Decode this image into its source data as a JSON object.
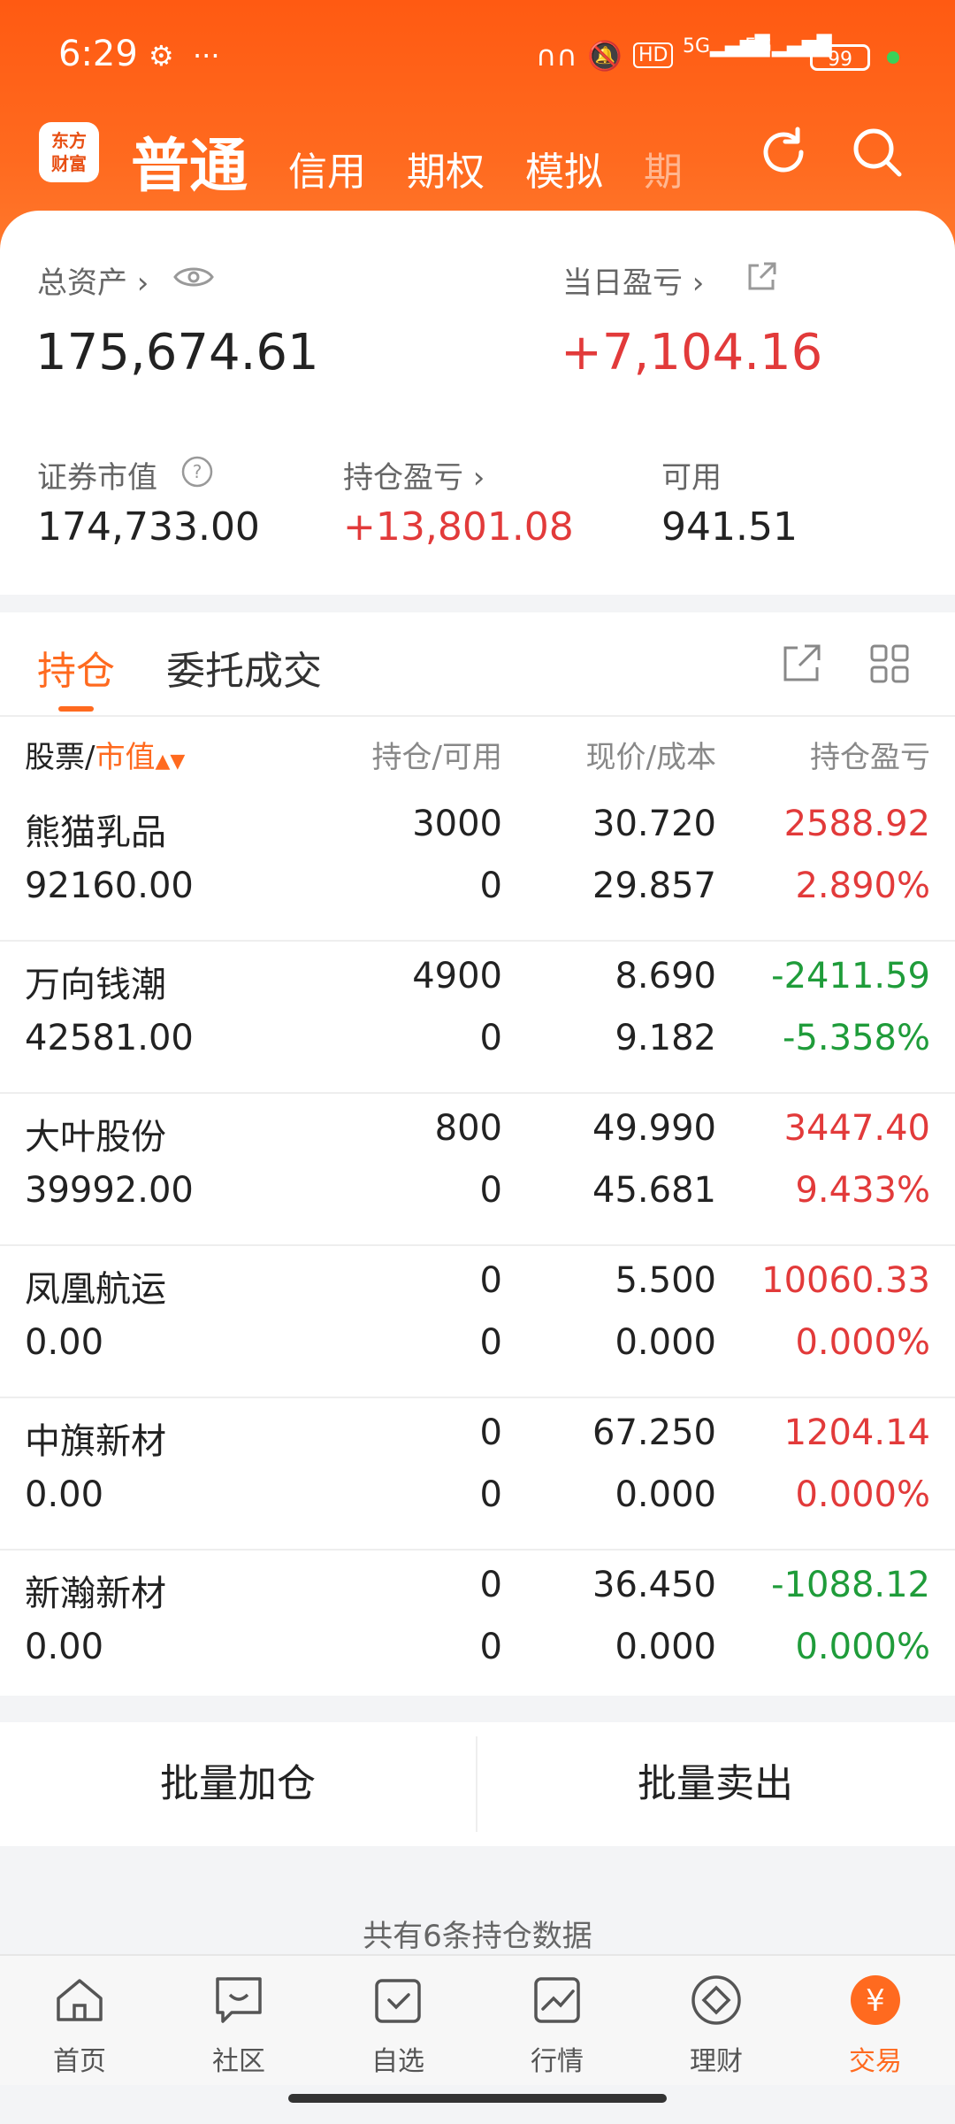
{
  "status": {
    "time": "6:29",
    "network": "5G",
    "battery": "99"
  },
  "nav": {
    "logo_line1": "东方",
    "logo_line2": "财富",
    "tabs": [
      "普通",
      "信用",
      "期权",
      "模拟",
      "期"
    ]
  },
  "summary": {
    "total_assets_label": "总资产",
    "total_assets_value": "175,674.61",
    "daily_pnl_label": "当日盈亏",
    "daily_pnl_value": "+7,104.16",
    "market_value_label": "证券市值",
    "market_value": "174,733.00",
    "position_pnl_label": "持仓盈亏",
    "position_pnl_value": "+13,801.08",
    "available_label": "可用",
    "available_value": "941.51"
  },
  "tabs": {
    "positions": "持仓",
    "orders": "委托成交"
  },
  "columns": {
    "stock": "股票/",
    "sort": "市值",
    "holdings": "持仓/可用",
    "price": "现价/成本",
    "pnl": "持仓盈亏"
  },
  "rows": [
    {
      "name": "熊猫乳品",
      "mv": "92160.00",
      "hold": "3000",
      "avail": "0",
      "price": "30.720",
      "cost": "29.857",
      "pnl": "2588.92",
      "pct": "2.890%",
      "color": "#e23a3a"
    },
    {
      "name": "万向钱潮",
      "mv": "42581.00",
      "hold": "4900",
      "avail": "0",
      "price": "8.690",
      "cost": "9.182",
      "pnl": "-2411.59",
      "pct": "-5.358%",
      "color": "#1f9c3a"
    },
    {
      "name": "大叶股份",
      "mv": "39992.00",
      "hold": "800",
      "avail": "0",
      "price": "49.990",
      "cost": "45.681",
      "pnl": "3447.40",
      "pct": "9.433%",
      "color": "#e23a3a"
    },
    {
      "name": "凤凰航运",
      "mv": "0.00",
      "hold": "0",
      "avail": "0",
      "price": "5.500",
      "cost": "0.000",
      "pnl": "10060.33",
      "pct": "0.000%",
      "color": "#e23a3a"
    },
    {
      "name": "中旗新材",
      "mv": "0.00",
      "hold": "0",
      "avail": "0",
      "price": "67.250",
      "cost": "0.000",
      "pnl": "1204.14",
      "pct": "0.000%",
      "color": "#e23a3a"
    },
    {
      "name": "新瀚新材",
      "mv": "0.00",
      "hold": "0",
      "avail": "0",
      "price": "36.450",
      "cost": "0.000",
      "pnl": "-1088.12",
      "pct": "0.000%",
      "color": "#1f9c3a"
    }
  ],
  "actions": {
    "batch_add": "批量加仓",
    "batch_sell": "批量卖出"
  },
  "footer_text": "共有6条持仓数据",
  "bottom_nav": [
    "首页",
    "社区",
    "自选",
    "行情",
    "理财",
    "交易"
  ],
  "colors": {
    "accent": "#ff6a1f",
    "up": "#e23a3a",
    "down": "#1f9c3a"
  }
}
